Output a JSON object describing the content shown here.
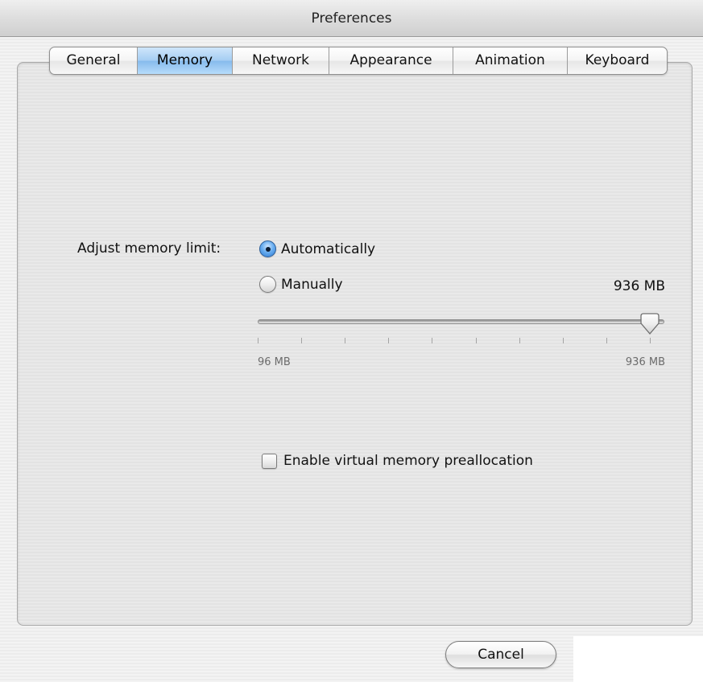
{
  "window": {
    "title": "Preferences"
  },
  "tabs": [
    {
      "label": "General",
      "selected": false
    },
    {
      "label": "Memory",
      "selected": true
    },
    {
      "label": "Network",
      "selected": false
    },
    {
      "label": "Appearance",
      "selected": false
    },
    {
      "label": "Animation",
      "selected": false
    },
    {
      "label": "Keyboard",
      "selected": false
    }
  ],
  "memory": {
    "adjust_label": "Adjust memory limit:",
    "options": [
      {
        "label": "Automatically",
        "selected": true
      },
      {
        "label": "Manually",
        "selected": false
      }
    ],
    "current_value": "936 MB",
    "slider": {
      "min_label": "96 MB",
      "max_label": "936 MB",
      "value_fraction": 1.0,
      "tick_count": 10
    },
    "preallocation": {
      "label": "Enable virtual memory preallocation",
      "checked": false
    }
  },
  "buttons": {
    "cancel": "Cancel"
  },
  "colors": {
    "selection_blue": "#86baec",
    "radio_blue": "#2f7bd3"
  }
}
